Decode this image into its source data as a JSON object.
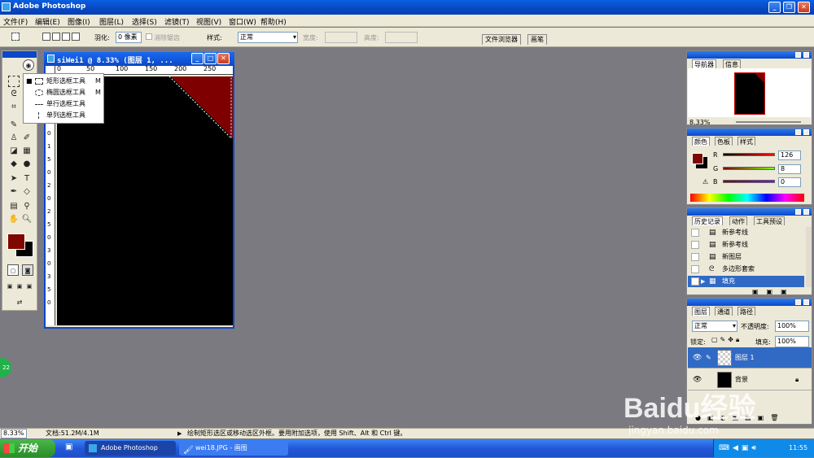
{
  "app": {
    "title": "Adobe Photoshop"
  },
  "menu": [
    "文件(F)",
    "编辑(E)",
    "图像(I)",
    "图层(L)",
    "选择(S)",
    "滤镜(T)",
    "视图(V)",
    "窗口(W)",
    "帮助(H)"
  ],
  "options": {
    "feather_label": "羽化:",
    "feather_value": "0 像素",
    "antialias_label": "消除锯齿",
    "style_label": "样式:",
    "style_value": "正常",
    "width_label": "宽度:",
    "height_label": "高度:",
    "tab_file_browser": "文件浏览器",
    "tab_brushes": "画笔"
  },
  "document": {
    "title": "siWei1 @ 8.33% (图层 1, ...",
    "ruler_ticks": [
      "0",
      "50",
      "100",
      "150",
      "200",
      "250"
    ],
    "left_ruler_ticks": [
      "1",
      "5",
      "0",
      "1",
      "0",
      "1",
      "5",
      "0",
      "2",
      "0",
      "2",
      "5",
      "0",
      "3",
      "0",
      "3",
      "5",
      "0"
    ]
  },
  "flyout": [
    {
      "name": "矩形选框工具",
      "key": "M",
      "icon": "rect-marquee-icon"
    },
    {
      "name": "椭圆选框工具",
      "key": "M",
      "icon": "ellipse-marquee-icon"
    },
    {
      "name": "单行选框工具",
      "key": "",
      "icon": "single-row-marquee-icon"
    },
    {
      "name": "单列选框工具",
      "key": "",
      "icon": "single-column-marquee-icon"
    }
  ],
  "navigator": {
    "tabs": [
      "导航器",
      "信息"
    ],
    "zoom": "8.33%"
  },
  "color": {
    "tabs": [
      "颜色",
      "色板",
      "样式"
    ],
    "r_label": "R",
    "g_label": "G",
    "b_label": "B",
    "r": "126",
    "g": "8",
    "b": "0",
    "foreground": "#7e0800"
  },
  "history": {
    "tabs": [
      "历史记录",
      "动作",
      "工具预设"
    ],
    "items": [
      {
        "name": "新参考线",
        "selected": false
      },
      {
        "name": "新参考线",
        "selected": false
      },
      {
        "name": "新图层",
        "selected": false
      },
      {
        "name": "多边形套索",
        "selected": false
      },
      {
        "name": "填充",
        "selected": true
      }
    ]
  },
  "layers": {
    "tabs": [
      "图层",
      "通道",
      "路径"
    ],
    "blend": "正常",
    "opacity_label": "不透明度:",
    "opacity": "100%",
    "lock_label": "锁定:",
    "fill_label": "填充:",
    "fill": "100%",
    "items": [
      {
        "name": "图层 1",
        "selected": true
      },
      {
        "name": "背景",
        "selected": false
      }
    ]
  },
  "status": {
    "zoom": "8.33%",
    "doc": "文档:51.2M/4.1M",
    "hint": "绘制矩形选区或移动选区外框。要用附加选项，使用 Shift、Alt 和 Ctrl 键。"
  },
  "taskbar": {
    "start": "开始",
    "items": [
      "Adobe Photoshop",
      "wei18.JPG - 画图"
    ],
    "clock": "11:55"
  },
  "watermark": {
    "brand": "Baidu经验",
    "url": "jingyan.baidu.com"
  },
  "badge": "22"
}
